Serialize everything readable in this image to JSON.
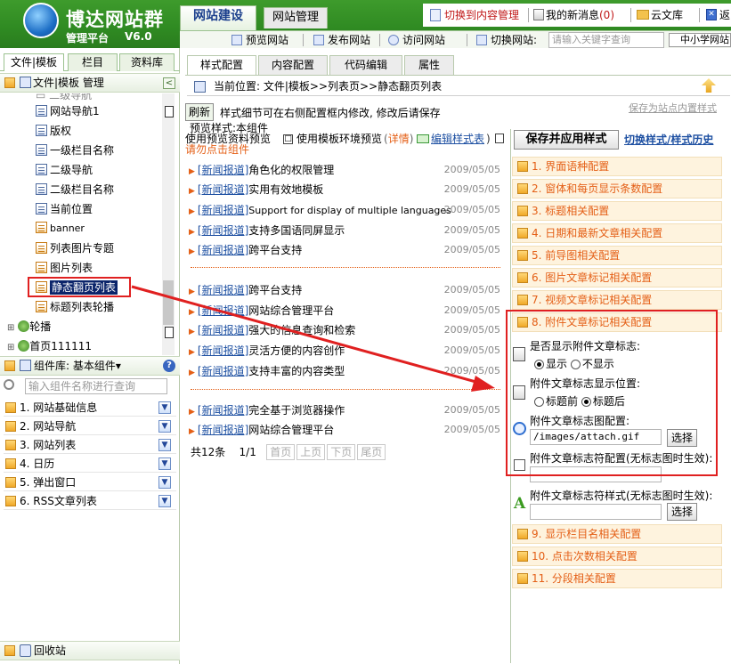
{
  "header": {
    "logo": "博达网站群",
    "sub": "管理平台",
    "version": "V6.0",
    "tabs": [
      "网站建设",
      "网站管理"
    ],
    "links": {
      "switch_content": "切换到内容管理",
      "messages": "我的新消息",
      "msg_count": "(0)",
      "cloud": "云文库",
      "exit": "返"
    },
    "toolbar": {
      "preview": "预览网站",
      "publish": "发布网站",
      "visit": "访问网站",
      "switch_site": "切换网站:",
      "search_placeholder": "请输入关键字查询",
      "site_name": "中小学网站"
    }
  },
  "left": {
    "tabs": [
      "文件|模板",
      "栏目",
      "资料库"
    ],
    "tree_header": "文件|模板 管理",
    "tree": [
      "网站导航1",
      "版权",
      "一级栏目名称",
      "二级导航",
      "二级栏目名称",
      "当前位置",
      "banner",
      "列表图片专题",
      "图片列表",
      "静态翻页列表",
      "标题列表轮播"
    ],
    "tree_top": [
      "轮播",
      "首页111111"
    ],
    "component_header": "组件库: 基本组件▾",
    "component_search": "输入组件名称进行查询",
    "components": [
      "1. 网站基础信息",
      "2. 网站导航",
      "3. 网站列表",
      "4. 日历",
      "5. 弹出窗口",
      "6. RSS文章列表"
    ],
    "recycle": "回收站"
  },
  "mid": {
    "tabs": [
      "样式配置",
      "内容配置",
      "代码编辑",
      "属性"
    ],
    "breadcrumb": "当前位置: 文件|模板>>列表页>>静态翻页列表",
    "refresh": "刷新",
    "hint": "样式细节可在右侧配置框内修改, 修改后请保存",
    "save_site": "保存为站点内置样式",
    "preview_title": "预览样式:本组件",
    "preview_opts": "使用预览资料预览",
    "template_preview": "使用模板环境预览",
    "detail": "详情",
    "edit_style": "编辑样式表",
    "no_click": "请勿点击组件",
    "news1": [
      {
        "cat": "[新闻报道]",
        "title": "角色化的权限管理",
        "date": "2009/05/05"
      },
      {
        "cat": "[新闻报道]",
        "title": "实用有效地模板",
        "date": "2009/05/05"
      },
      {
        "cat": "[新闻报道]",
        "title": "Support for display of multiple languages",
        "date": "2009/05/05"
      },
      {
        "cat": "[新闻报道]",
        "title": "支持多国语同屏显示",
        "date": "2009/05/05"
      },
      {
        "cat": "[新闻报道]",
        "title": "跨平台支持",
        "date": "2009/05/05"
      }
    ],
    "news2": [
      {
        "cat": "[新闻报道]",
        "title": "跨平台支持",
        "date": "2009/05/05"
      },
      {
        "cat": "[新闻报道]",
        "title": "网站综合管理平台",
        "date": "2009/05/05"
      },
      {
        "cat": "[新闻报道]",
        "title": "强大的信息查询和检索",
        "date": "2009/05/05"
      },
      {
        "cat": "[新闻报道]",
        "title": "灵活方便的内容创作",
        "date": "2009/05/05"
      },
      {
        "cat": "[新闻报道]",
        "title": "支持丰富的内容类型",
        "date": "2009/05/05"
      }
    ],
    "news3": [
      {
        "cat": "[新闻报道]",
        "title": "完全基于浏览器操作",
        "date": "2009/05/05"
      },
      {
        "cat": "[新闻报道]",
        "title": "网站综合管理平台",
        "date": "2009/05/05"
      }
    ],
    "pager": {
      "total": "共12条",
      "page": "1/1",
      "first": "首页",
      "prev": "上页",
      "next": "下页",
      "last": "尾页"
    }
  },
  "right": {
    "save_apply": "保存并应用样式",
    "switch_history": "切换样式/样式历史",
    "configs": [
      "1. 界面语种配置",
      "2. 窗体和每页显示条数配置",
      "3. 标题相关配置",
      "4. 日期和最新文章相关配置",
      "5. 前导图相关配置",
      "6. 图片文章标记相关配置",
      "7. 视频文章标记相关配置",
      "8. 附件文章标记相关配置",
      "9. 显示栏目名相关配置",
      "10. 点击次数相关配置",
      "11. 分段相关配置"
    ],
    "attach": {
      "q1": "是否显示附件文章标志:",
      "show": "显示",
      "hide": "不显示",
      "q2": "附件文章标志显示位置:",
      "before": "标题前",
      "after": "标题后",
      "q3": "附件文章标志图配置:",
      "img_path": "/images/attach.gif",
      "choose": "选择",
      "q4": "附件文章标志符配置(无标志图时生效):",
      "q5": "附件文章标志符样式(无标志图时生效):"
    }
  },
  "colors": {
    "green": "#2f8a22",
    "orange": "#e45f16",
    "blue": "#1e50a2",
    "red": "#e02020"
  }
}
